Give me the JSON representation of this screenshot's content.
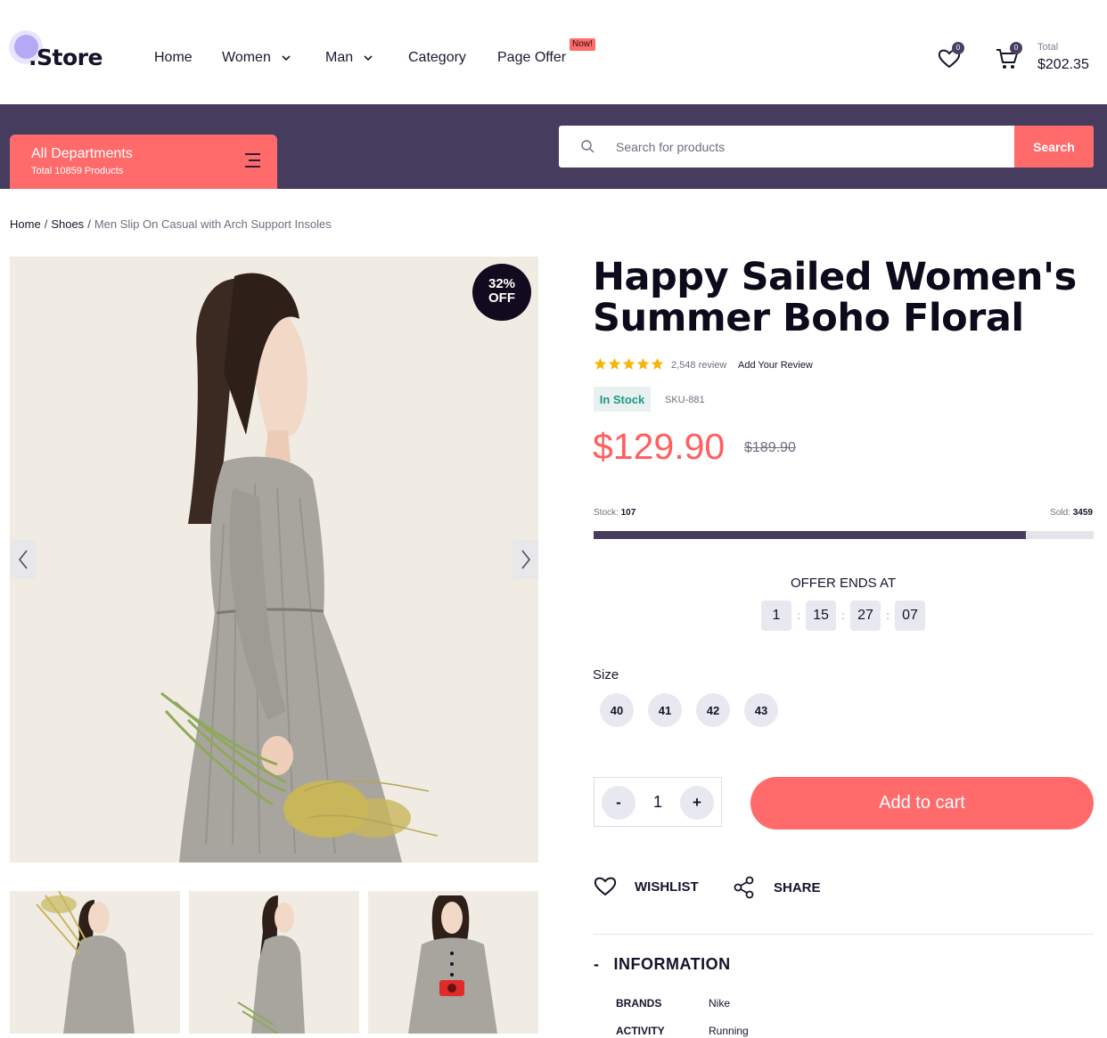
{
  "brand": {
    "name": ".Store"
  },
  "nav": {
    "items": [
      {
        "label": "Home",
        "dropdown": false
      },
      {
        "label": "Women",
        "dropdown": true
      },
      {
        "label": "Man",
        "dropdown": true
      },
      {
        "label": "Category",
        "dropdown": false
      },
      {
        "label": "Page Offer",
        "dropdown": false,
        "badge": "Now!"
      }
    ]
  },
  "header_actions": {
    "wishlist_count": "0",
    "cart_count": "0",
    "total_label": "Total",
    "total_value": "$202.35"
  },
  "departments": {
    "label": "All Departments",
    "sub": "Total 10859 Products"
  },
  "search": {
    "placeholder": "Search for products",
    "button": "Search"
  },
  "breadcrumb": [
    "Home",
    "Shoes",
    "Men Slip On Casual with Arch Support Insoles"
  ],
  "gallery": {
    "discount_badge_line1": "32%",
    "discount_badge_line2": "OFF",
    "thumbnail_count": 3
  },
  "product": {
    "title": "Happy Sailed Women's Summer Boho Floral",
    "rating": 5,
    "reviews": "2,548 review",
    "add_review": "Add Your Review",
    "stock_status": "In Stock",
    "sku": "SKU-881",
    "price": "$129.90",
    "old_price": "$189.90",
    "stock_label": "Stock:",
    "stock_value": "107",
    "sold_label": "Sold:",
    "sold_value": "3459",
    "sold_fraction": 0.865,
    "offer_label": "OFFER ENDS AT",
    "timer": [
      "1",
      "15",
      "27",
      "07"
    ],
    "size_label": "Size",
    "sizes": [
      "40",
      "41",
      "42",
      "43"
    ],
    "quantity": "1",
    "qty_minus": "-",
    "qty_plus": "+",
    "add_to_cart": "Add to cart",
    "wishlist": "WISHLIST",
    "share": "SHARE"
  },
  "information": {
    "heading": "INFORMATION",
    "dash": "-",
    "rows": [
      {
        "key": "BRANDS",
        "value": "Nike"
      },
      {
        "key": "ACTIVITY",
        "value": "Running"
      }
    ]
  },
  "colors": {
    "accent": "#ff6b6b",
    "band": "#463c5e",
    "image_bg": "#f0ece4",
    "dark": "#15132a"
  }
}
